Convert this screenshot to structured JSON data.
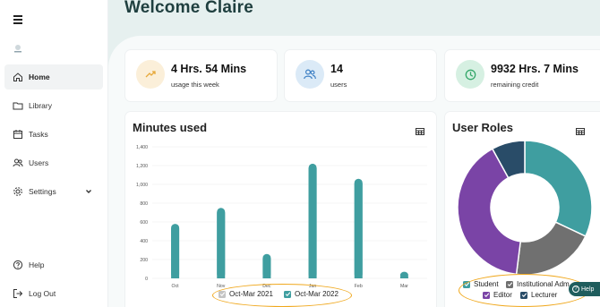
{
  "sidebar": {
    "items": [
      {
        "label": "Home",
        "icon": "home-icon"
      },
      {
        "label": "Library",
        "icon": "folder-icon"
      },
      {
        "label": "Tasks",
        "icon": "calendar-icon"
      },
      {
        "label": "Users",
        "icon": "users-icon"
      },
      {
        "label": "Settings",
        "icon": "gear-icon"
      }
    ],
    "bottom": [
      {
        "label": "Help",
        "icon": "help-icon"
      },
      {
        "label": "Log Out",
        "icon": "logout-icon"
      }
    ]
  },
  "header": {
    "welcome": "Welcome Claire"
  },
  "stats": [
    {
      "value": "4 Hrs. 54 Mins",
      "label": "usage this week",
      "icon": "trend-up-icon",
      "color": "#fbefd9",
      "icon_color": "#e7a93b"
    },
    {
      "value": "14",
      "label": "users",
      "icon": "users-icon",
      "color": "#dbeaf7",
      "icon_color": "#3c7fc4"
    },
    {
      "value": "9932 Hrs. 7 Mins",
      "label": "remaining credit",
      "icon": "clock-icon",
      "color": "#d6f0e2",
      "icon_color": "#36a86b"
    }
  ],
  "minutes_chart": {
    "title": "Minutes used",
    "legend": [
      "Oct-Mar 2021",
      "Oct-Mar 2022"
    ]
  },
  "roles_chart": {
    "title": "User Roles",
    "legend": [
      "Student",
      "Institutional Adm",
      "Editor",
      "Lecturer"
    ]
  },
  "help_button": "Help",
  "colors": {
    "accent": "#3f9ea0",
    "student": "#3f9ea0",
    "institutional_admin": "#707070",
    "editor": "#7a44a6",
    "lecturer": "#294c68",
    "highlight": "#f0a81d"
  },
  "chart_data": [
    {
      "type": "bar",
      "title": "Minutes used",
      "categories": [
        "Oct",
        "Nov",
        "Dec",
        "Jan",
        "Feb",
        "Mar"
      ],
      "series": [
        {
          "name": "Oct-Mar 2021",
          "values": [
            0,
            0,
            0,
            0,
            0,
            0
          ]
        },
        {
          "name": "Oct-Mar 2022",
          "values": [
            580,
            750,
            260,
            1220,
            1060,
            70
          ]
        }
      ],
      "yticks": [
        0,
        200,
        400,
        600,
        800,
        1000,
        1200,
        1400
      ],
      "ytick_labels": [
        "0",
        "200",
        "400",
        "600",
        "800",
        "1,000",
        "1,200",
        "1,400"
      ],
      "ylim": [
        0,
        1400
      ],
      "grid": true,
      "legend": "bottom"
    },
    {
      "type": "pie",
      "title": "User Roles",
      "labels": [
        "Student",
        "Institutional Admin",
        "Editor",
        "Lecturer"
      ],
      "values": [
        32,
        20,
        40,
        8
      ],
      "donut": true,
      "legend": "bottom"
    }
  ]
}
